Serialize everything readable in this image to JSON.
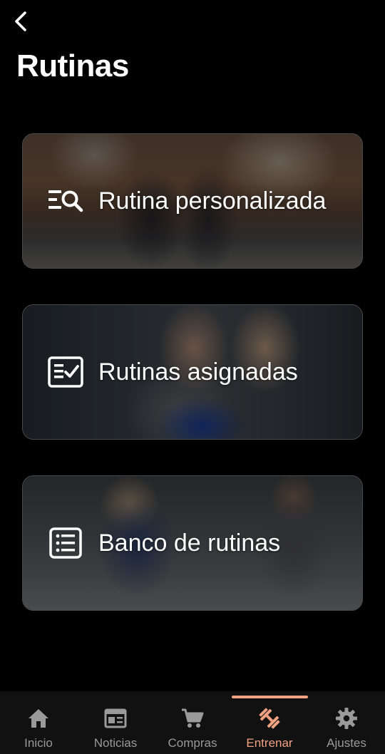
{
  "header": {
    "back_icon": "chevron-left-icon",
    "title": "Rutinas"
  },
  "cards": [
    {
      "label": "Rutina personalizada",
      "icon": "list-search-icon"
    },
    {
      "label": "Rutinas asignadas",
      "icon": "checklist-icon"
    },
    {
      "label": "Banco de rutinas",
      "icon": "list-icon"
    }
  ],
  "tab_bar": {
    "items": [
      {
        "label": "Inicio",
        "icon": "home-icon"
      },
      {
        "label": "Noticias",
        "icon": "newspaper-icon"
      },
      {
        "label": "Compras",
        "icon": "cart-icon"
      },
      {
        "label": "Entrenar",
        "icon": "dumbbell-icon"
      },
      {
        "label": "Ajustes",
        "icon": "gear-icon"
      }
    ],
    "active": "Entrenar"
  },
  "colors": {
    "background": "#000000",
    "accent": "#f0a283",
    "tab_inactive": "#9a9a9a",
    "tab_bar": "#111111"
  }
}
